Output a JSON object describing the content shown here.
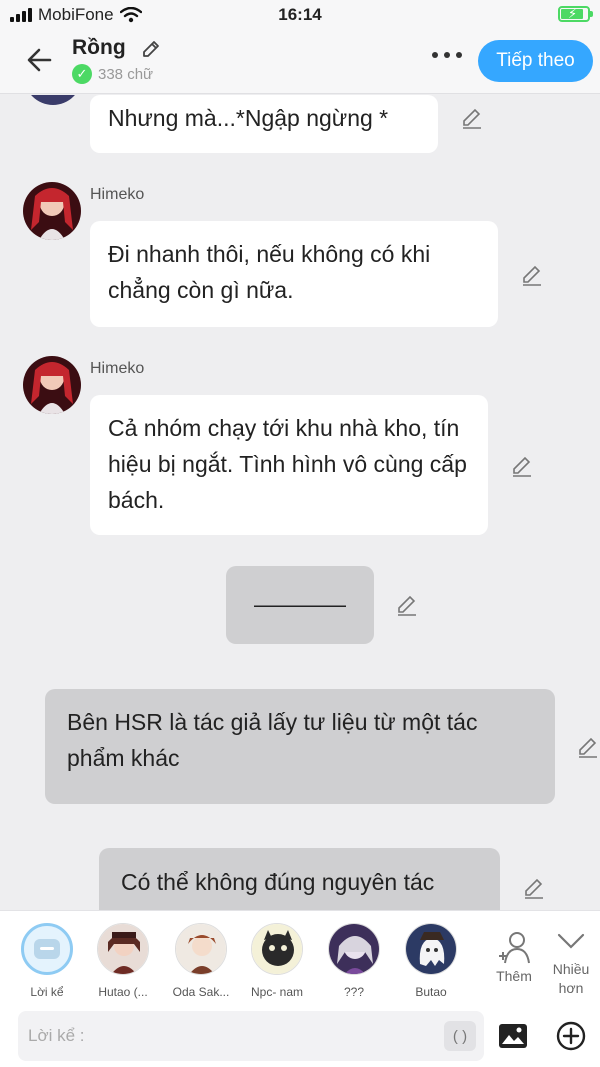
{
  "status_bar": {
    "carrier": "MobiFone",
    "time": "16:14",
    "battery_level": 0.8
  },
  "header": {
    "title": "Rồng",
    "word_count": "338 chữ",
    "next_label": "Tiếp theo"
  },
  "messages": [
    {
      "text": "Nhưng mà...*Ngập ngừng *"
    },
    {
      "speaker": "Himeko",
      "text": "Đi nhanh thôi, nếu không có khi chẳng còn gì nữa."
    },
    {
      "speaker": "Himeko",
      "text": "Cả nhóm chạy tới khu nhà kho, tín hiệu bị ngắt. Tình hình vô cùng cấp bách."
    },
    {
      "text": "————"
    },
    {
      "text": "Bên HSR là tác giả lấy tư liệu từ một tác phẩm khác"
    },
    {
      "text": "Có thể không đúng nguyên tác"
    }
  ],
  "characters": [
    {
      "name": "Lời kể"
    },
    {
      "name": "Hutao (..."
    },
    {
      "name": "Oda Sak..."
    },
    {
      "name": "Npc- nam"
    },
    {
      "name": "???"
    },
    {
      "name": "Butao"
    }
  ],
  "actions": {
    "add_label": "Thêm",
    "more_label": "Nhiều hơn"
  },
  "input": {
    "placeholder": "Lời kể :",
    "paren_label": "( )"
  },
  "colors": {
    "accent": "#35a7ff",
    "check": "#4cd964",
    "grey_bubble": "#cfcfd1",
    "background": "#eeeef0"
  }
}
